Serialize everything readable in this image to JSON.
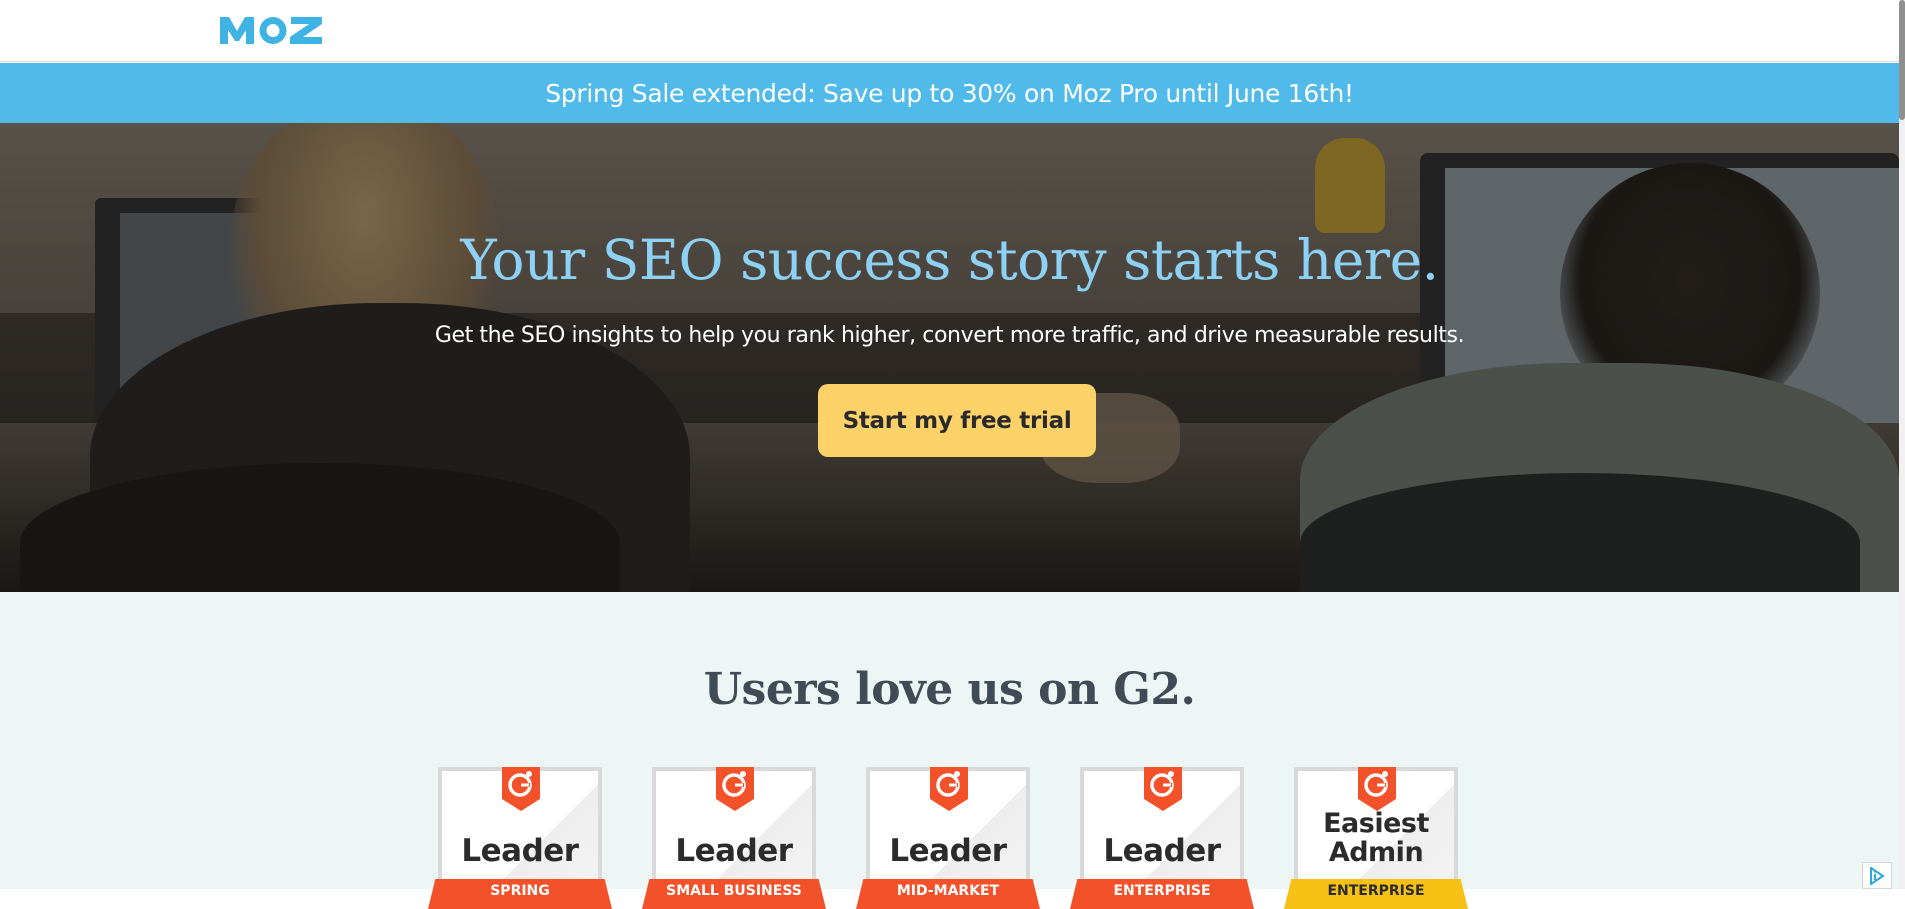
{
  "nav": {
    "logo_text": "MOZ",
    "logo_color": "#3fb4e4"
  },
  "banner": {
    "text": "Spring Sale extended: Save up to 30% on Moz Pro until June 16th!",
    "background": "#50bbeb"
  },
  "hero": {
    "title": "Your SEO success story starts here.",
    "subtitle": "Get the SEO insights to help you rank higher, convert more traffic, and drive measurable results.",
    "cta_label": "Start my free trial",
    "title_color": "#8dd1f5",
    "cta_color": "#fdd268"
  },
  "g2": {
    "heading": "Users love us on G2.",
    "badges": [
      {
        "title": "Leader",
        "ribbon": "SPRING",
        "ribbon_color": "#f3512a"
      },
      {
        "title": "Leader",
        "ribbon": "Small Business",
        "ribbon_color": "#f3512a"
      },
      {
        "title": "Leader",
        "ribbon": "Mid-Market",
        "ribbon_color": "#f3512a"
      },
      {
        "title": "Leader",
        "ribbon": "Enterprise",
        "ribbon_color": "#f3512a"
      },
      {
        "title_line1": "Easiest",
        "title_line2": "Admin",
        "ribbon": "Enterprise",
        "ribbon_color": "#f6c114"
      }
    ],
    "badge_icon": "g2-logo-icon"
  },
  "adchoices": {
    "icon": "adchoices-icon"
  }
}
